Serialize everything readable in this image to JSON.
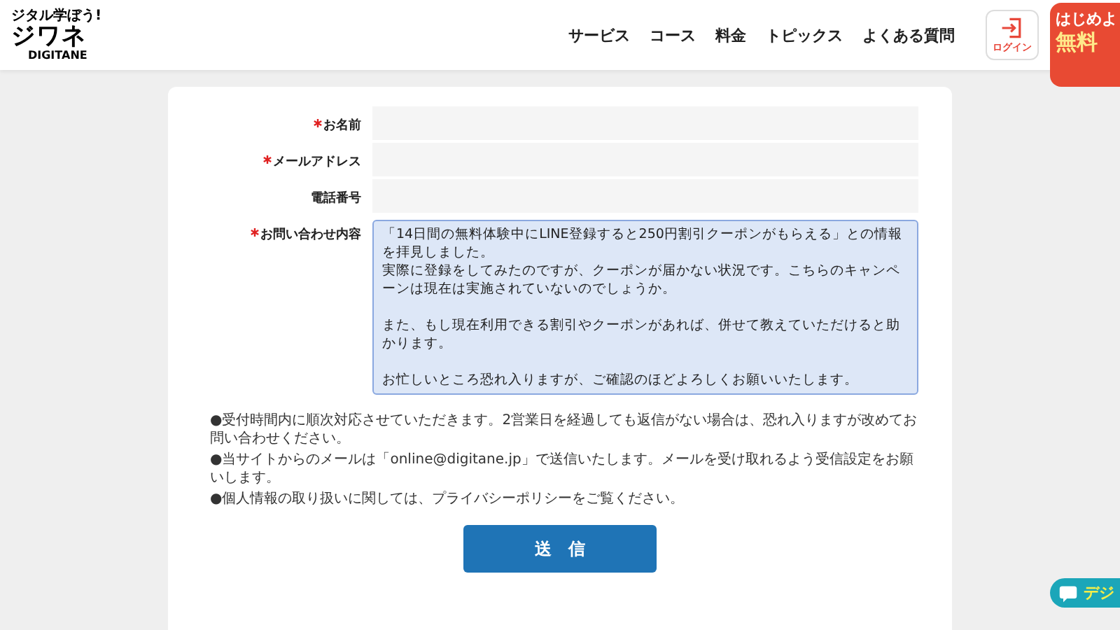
{
  "header": {
    "tagline": "ジタル学ぼう!",
    "logo": "ジワネ",
    "logo_sub": "DIGITANE",
    "nav": [
      "サービス",
      "コース",
      "料金",
      "トピックス",
      "よくある質問"
    ],
    "login": "ログイン",
    "cta": {
      "line_1": "はじめよ",
      "line_2": "無料"
    }
  },
  "form": {
    "fields": [
      {
        "label": "お名前",
        "required": true,
        "kind": "input"
      },
      {
        "label": "メールアドレス",
        "required": true,
        "kind": "input"
      },
      {
        "label": "電話番号",
        "required": false,
        "kind": "input"
      },
      {
        "label": "お問い合わせ内容",
        "required": true,
        "kind": "textarea",
        "paragraphs": [
          [
            "「14日間の無料体験中にLINE登録すると250円割引クーポンがもらえる」との情報を拝見しました。",
            "実際に登録をしてみたのですが、クーポンが届かない状況です。こちらのキャンペーンは現在は実施されていないのでしょうか。"
          ],
          [
            "また、もし現在利用できる割引やクーポンがあれば、併せて教えていただけると助かります。"
          ],
          [
            "お忙しいところ恐れ入りますが、ご確認のほどよろしくお願いいたします。"
          ]
        ]
      }
    ],
    "notes": [
      "●受付時間内に順次対応させていただきます。2営業日を経過しても返信がない場合は、恐れ入りますが改めてお問い合わせください。",
      "●当サイトからのメールは「online@digitane.jp」で送信いたします。メールを受け取れるよう受信設定をお願いします。",
      "●個人情報の取り扱いに関しては、プライバシーポリシーをご覧ください。"
    ],
    "submit": "送　信"
  },
  "chat_badge": "デジ"
}
